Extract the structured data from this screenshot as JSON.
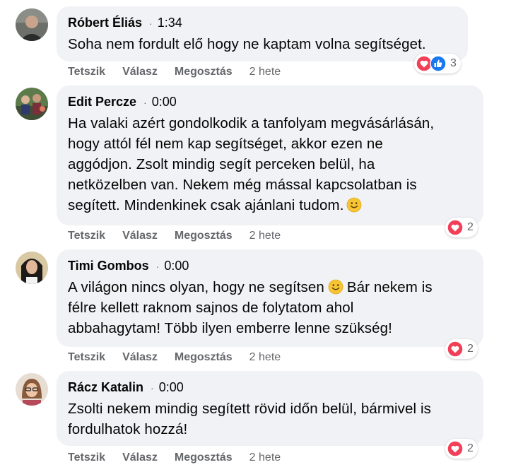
{
  "colors": {
    "bubble_bg": "#f0f2f5",
    "secondary_text": "#65676b",
    "love": "#f33e58",
    "like": "#1877f2"
  },
  "action_labels": {
    "like": "Tetszik",
    "reply": "Válasz",
    "share": "Megosztás"
  },
  "comments": [
    {
      "author": "Róbert Éliás",
      "time": "1:34",
      "text": "Soha nem fordult elő hogy ne kaptam volna segítséget.",
      "ago": "2 hete",
      "reactions": [
        "love-icon",
        "like-icon"
      ],
      "reaction_count": "3"
    },
    {
      "author": "Edit Percze",
      "time": "0:00",
      "text_lines": [
        "Ha valaki azért gondolkodik a tanfolyam megvásárlásán,",
        "hogy attól fél nem kap segítséget, akkor ezen ne",
        "aggódjon. Zsolt mindig segít perceken belül, ha",
        "netközelben van. Nekem még mással kapcsolatban is",
        "segített. Mindenkinek csak ajánlani tudom."
      ],
      "ago": "2 hete",
      "reactions": [
        "love-icon"
      ],
      "reaction_count": "2"
    },
    {
      "author": "Timi Gombos",
      "time": "0:00",
      "text_lines": [
        "A világon nincs olyan, hogy ne segítsen",
        "Bár nekem is",
        "félre kellett raknom sajnos de folytatom ahol",
        "abbahagytam! Több ilyen emberre lenne szükség!"
      ],
      "ago": "2 hete",
      "reactions": [
        "love-icon"
      ],
      "reaction_count": "2"
    },
    {
      "author": "Rácz Katalin",
      "time": "0:00",
      "text_lines": [
        "Zsolti nekem mindig segített rövid időn belül, bármivel is",
        "fordulhatok hozzá!"
      ],
      "ago": "2 hete",
      "reactions": [
        "love-icon"
      ],
      "reaction_count": "2"
    }
  ]
}
